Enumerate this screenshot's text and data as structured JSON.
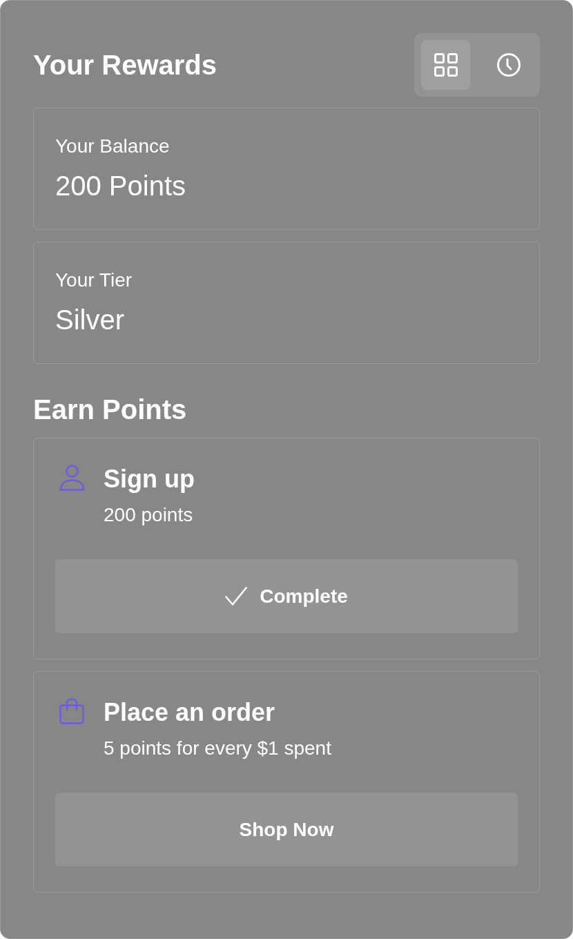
{
  "header": {
    "title": "Your Rewards",
    "view_toggle": [
      {
        "kind": "grid",
        "selected": true
      },
      {
        "kind": "clock",
        "selected": false
      }
    ]
  },
  "summary_cards": [
    {
      "label": "Your Balance",
      "value": "200 Points"
    },
    {
      "label": "Your Tier",
      "value": "Silver"
    }
  ],
  "earn_points": {
    "title": "Earn Points",
    "tasks": [
      {
        "kind": "user",
        "title": "Sign up",
        "description": "200 points",
        "button": {
          "label": "Complete",
          "completed": true
        }
      },
      {
        "kind": "bag",
        "title": "Place an order",
        "description": "5 points for every $1 spent",
        "button": {
          "label": "Shop Now",
          "completed": false
        }
      }
    ]
  }
}
